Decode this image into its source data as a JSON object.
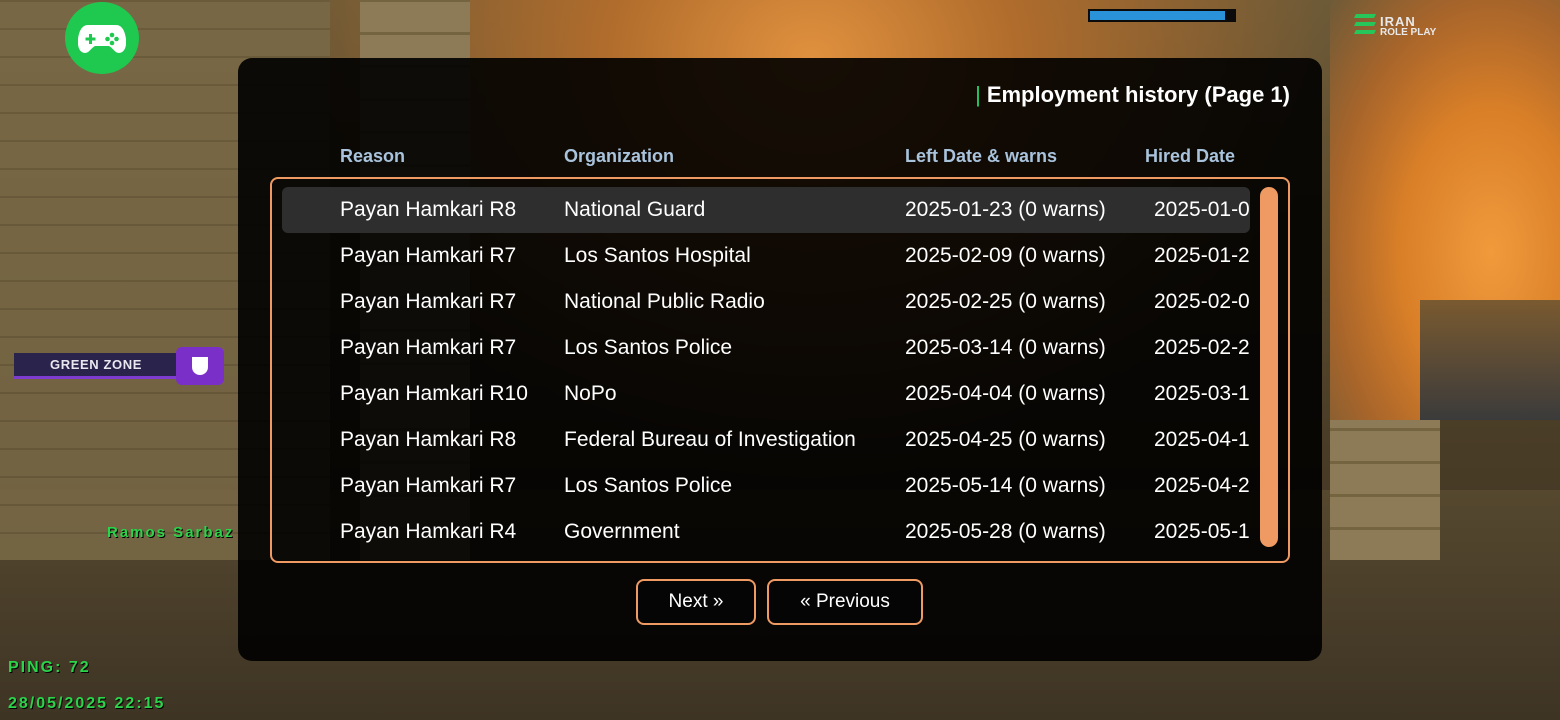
{
  "hud": {
    "health_fill_percent": 94,
    "logo": {
      "line1": "IRAN",
      "line2": "ROLE PLAY"
    },
    "zone_label": "GREEN ZONE",
    "player_name": "Ramos Sarbaz",
    "ping": "PING: 72",
    "datetime": "28/05/2025 22:15"
  },
  "dialog": {
    "title": "Employment history (Page 1)",
    "columns": {
      "reason": "Reason",
      "organization": "Organization",
      "left": "Left Date & warns",
      "hired": "Hired Date"
    },
    "rows": [
      {
        "reason": "Payan Hamkari R8",
        "organization": "National Guard",
        "left": "2025-01-23 (0 warns)",
        "hired": "2025-01-0"
      },
      {
        "reason": "Payan Hamkari R7",
        "organization": "Los Santos Hospital",
        "left": "2025-02-09 (0 warns)",
        "hired": "2025-01-2"
      },
      {
        "reason": "Payan Hamkari R7",
        "organization": "National Public Radio",
        "left": "2025-02-25 (0 warns)",
        "hired": "2025-02-0"
      },
      {
        "reason": "Payan Hamkari R7",
        "organization": "Los Santos Police",
        "left": "2025-03-14 (0 warns)",
        "hired": "2025-02-2"
      },
      {
        "reason": "Payan Hamkari R10",
        "organization": "NoPo",
        "left": "2025-04-04 (0 warns)",
        "hired": "2025-03-1"
      },
      {
        "reason": "Payan Hamkari R8",
        "organization": "Federal Bureau of Investigation",
        "left": "2025-04-25 (0 warns)",
        "hired": "2025-04-1"
      },
      {
        "reason": "Payan Hamkari R7",
        "organization": "Los Santos Police",
        "left": "2025-05-14 (0 warns)",
        "hired": "2025-04-2"
      },
      {
        "reason": "Payan Hamkari R4",
        "organization": "Government",
        "left": "2025-05-28 (0 warns)",
        "hired": "2025-05-1"
      }
    ],
    "selected_row": 0,
    "buttons": {
      "next": "Next »",
      "previous": "« Previous"
    }
  },
  "colors": {
    "accent": "#ee9a62",
    "header_text": "#a9c3dc",
    "title_mark": "#27d46a",
    "hud_green": "#2bd44a",
    "zone_purple": "#7b2fc9",
    "gamepad_green": "#1fc84f",
    "health_blue": "#2a92d8"
  }
}
